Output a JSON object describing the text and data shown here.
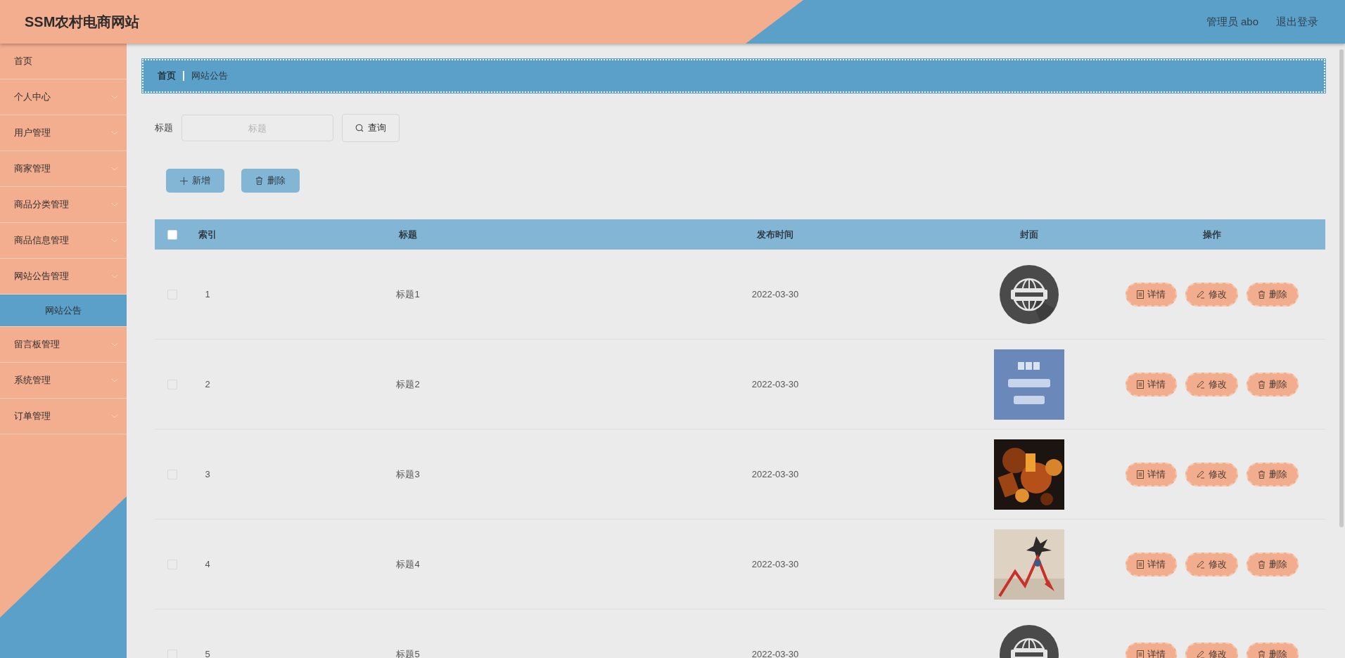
{
  "header": {
    "title": "SSM农村电商网站",
    "user": "管理员 abo",
    "logout": "退出登录"
  },
  "sidebar": {
    "items": [
      {
        "label": "首页",
        "kind": "link"
      },
      {
        "label": "个人中心",
        "kind": "menu"
      },
      {
        "label": "用户管理",
        "kind": "menu"
      },
      {
        "label": "商家管理",
        "kind": "menu"
      },
      {
        "label": "商品分类管理",
        "kind": "menu"
      },
      {
        "label": "商品信息管理",
        "kind": "menu"
      },
      {
        "label": "网站公告管理",
        "kind": "menu",
        "children": [
          {
            "label": "网站公告",
            "selected": true
          }
        ]
      },
      {
        "label": "留言板管理",
        "kind": "menu"
      },
      {
        "label": "系统管理",
        "kind": "menu"
      },
      {
        "label": "订单管理",
        "kind": "menu"
      }
    ]
  },
  "breadcrumb": [
    "首页",
    "网站公告"
  ],
  "search": {
    "label": "标题",
    "placeholder": "标题",
    "button": "查询"
  },
  "toolbar": [
    "新增",
    "删除"
  ],
  "table": {
    "header_checked": false,
    "columns": [
      "索引",
      "标题",
      "发布时间",
      "封面",
      "操作"
    ],
    "rows": [
      {
        "checked": false,
        "index": "1",
        "title": "标题1",
        "date": "2022-03-30",
        "actions": [
          "详情",
          "修改",
          "删除"
        ]
      },
      {
        "checked": false,
        "index": "2",
        "title": "标题2",
        "date": "2022-03-30",
        "actions": [
          "详情",
          "修改",
          "删除"
        ]
      },
      {
        "checked": false,
        "index": "3",
        "title": "标题3",
        "date": "2022-03-30",
        "actions": [
          "详情",
          "修改",
          "删除"
        ]
      },
      {
        "checked": false,
        "index": "4",
        "title": "标题4",
        "date": "2022-03-30",
        "actions": [
          "详情",
          "修改",
          "删除"
        ]
      },
      {
        "checked": false,
        "index": "5",
        "title": "标题5",
        "date": "2022-03-30",
        "actions": [
          "详情",
          "修改",
          "删除"
        ]
      }
    ]
  }
}
